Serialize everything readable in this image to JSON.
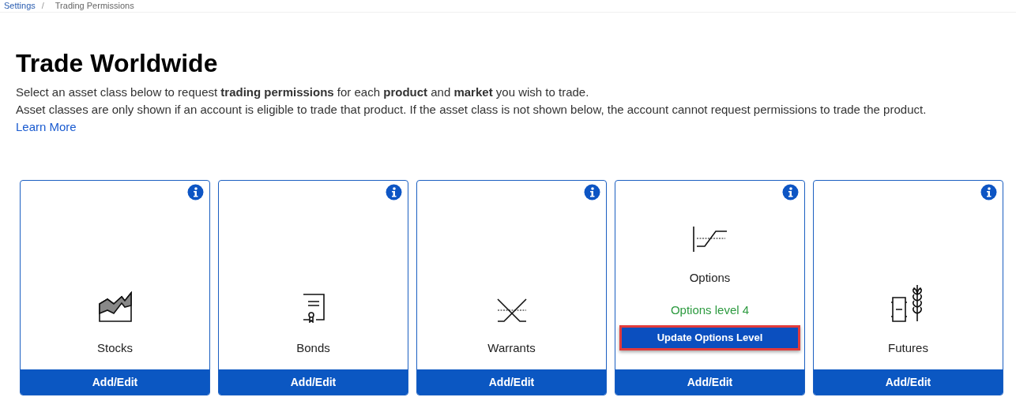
{
  "breadcrumb_separator": "/",
  "breadcrumbs": [
    {
      "label": "Settings",
      "link": true
    },
    {
      "label": "Trading Permissions",
      "link": false
    }
  ],
  "title": "Trade Worldwide",
  "description": [
    "Select an asset class below to request **trading permissions** for each **product** and **market** you wish to trade.",
    "Asset classes are only shown if an account is eligible to trade that product. If the asset class is not shown below, the account cannot request permissions to trade the product."
  ],
  "learn_more": "Learn More",
  "cards": [
    {
      "kind": "stocks",
      "name": "Stocks",
      "button": "Add/Edit"
    },
    {
      "kind": "bonds",
      "name": "Bonds",
      "button": "Add/Edit"
    },
    {
      "kind": "warrants",
      "name": "Warrants",
      "button": "Add/Edit"
    },
    {
      "kind": "options",
      "name": "Options",
      "status": "Options level 4",
      "action": {
        "label": "Update Options Level",
        "highlighted": true
      },
      "button": "Add/Edit"
    },
    {
      "kind": "futures",
      "name": "Futures",
      "button": "Add/Edit"
    }
  ]
}
